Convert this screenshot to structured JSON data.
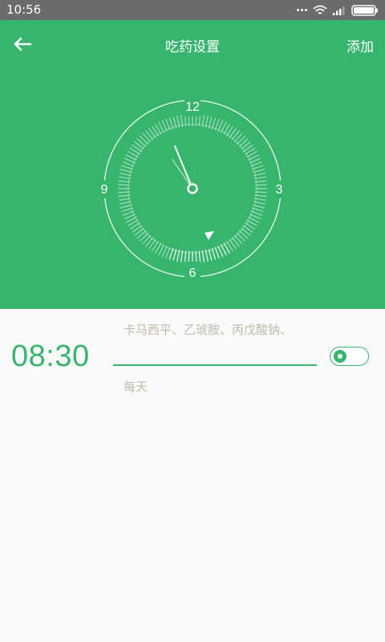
{
  "status_bar": {
    "time": "10:56"
  },
  "header": {
    "title": "吃药设置",
    "add_label": "添加"
  },
  "clock": {
    "numbers": {
      "twelve": "12",
      "three": "3",
      "six": "6",
      "nine": "9"
    }
  },
  "alarm": {
    "time": "08:30",
    "medicines": "卡马西平、乙琥胺、丙戊酸钠、",
    "repeat": "每天",
    "enabled": true
  },
  "colors": {
    "accent": "#37b46e",
    "muted_text": "#bdbba9",
    "status_bar": "#6b6b6b",
    "background": "#fafafa"
  },
  "icons": {
    "back": "arrow-left-icon"
  }
}
